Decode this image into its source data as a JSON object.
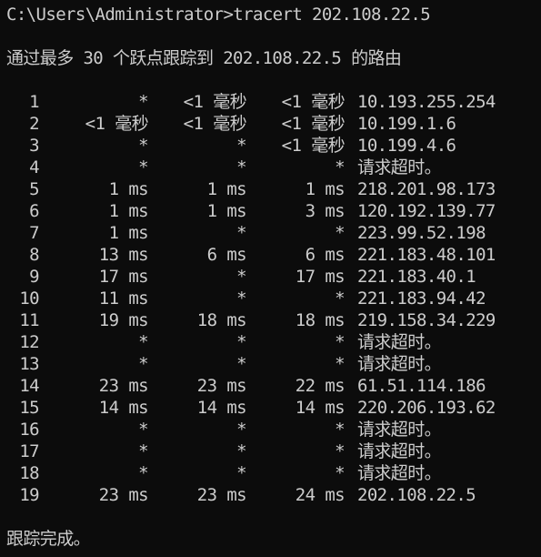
{
  "window": {
    "background": "#0c0c0c",
    "foreground": "#cccccc"
  },
  "command": {
    "prompt": "C:\\Users\\Administrator>",
    "text": "tracert 202.108.22.5"
  },
  "header": "通过最多 30 个跃点跟踪到 202.108.22.5 的路由",
  "hops": [
    {
      "num": "1",
      "t1": "*",
      "t2": "<1 毫秒",
      "t3": "<1 毫秒",
      "addr": "10.193.255.254"
    },
    {
      "num": "2",
      "t1": "<1 毫秒",
      "t2": "<1 毫秒",
      "t3": "<1 毫秒",
      "addr": "10.199.1.6"
    },
    {
      "num": "3",
      "t1": "*",
      "t2": "*",
      "t3": "<1 毫秒",
      "addr": "10.199.4.6"
    },
    {
      "num": "4",
      "t1": "*",
      "t2": "*",
      "t3": "*",
      "addr": "请求超时。"
    },
    {
      "num": "5",
      "t1": "1 ms",
      "t2": "1 ms",
      "t3": "1 ms",
      "addr": "218.201.98.173"
    },
    {
      "num": "6",
      "t1": "1 ms",
      "t2": "1 ms",
      "t3": "3 ms",
      "addr": "120.192.139.77"
    },
    {
      "num": "7",
      "t1": "1 ms",
      "t2": "*",
      "t3": "*",
      "addr": "223.99.52.198"
    },
    {
      "num": "8",
      "t1": "13 ms",
      "t2": "6 ms",
      "t3": "6 ms",
      "addr": "221.183.48.101"
    },
    {
      "num": "9",
      "t1": "17 ms",
      "t2": "*",
      "t3": "17 ms",
      "addr": "221.183.40.1"
    },
    {
      "num": "10",
      "t1": "11 ms",
      "t2": "*",
      "t3": "*",
      "addr": "221.183.94.42"
    },
    {
      "num": "11",
      "t1": "19 ms",
      "t2": "18 ms",
      "t3": "18 ms",
      "addr": "219.158.34.229"
    },
    {
      "num": "12",
      "t1": "*",
      "t2": "*",
      "t3": "*",
      "addr": "请求超时。"
    },
    {
      "num": "13",
      "t1": "*",
      "t2": "*",
      "t3": "*",
      "addr": "请求超时。"
    },
    {
      "num": "14",
      "t1": "23 ms",
      "t2": "23 ms",
      "t3": "22 ms",
      "addr": "61.51.114.186"
    },
    {
      "num": "15",
      "t1": "14 ms",
      "t2": "14 ms",
      "t3": "14 ms",
      "addr": "220.206.193.62"
    },
    {
      "num": "16",
      "t1": "*",
      "t2": "*",
      "t3": "*",
      "addr": "请求超时。"
    },
    {
      "num": "17",
      "t1": "*",
      "t2": "*",
      "t3": "*",
      "addr": "请求超时。"
    },
    {
      "num": "18",
      "t1": "*",
      "t2": "*",
      "t3": "*",
      "addr": "请求超时。"
    },
    {
      "num": "19",
      "t1": "23 ms",
      "t2": "23 ms",
      "t3": "24 ms",
      "addr": "202.108.22.5"
    }
  ],
  "footer": "跟踪完成。"
}
